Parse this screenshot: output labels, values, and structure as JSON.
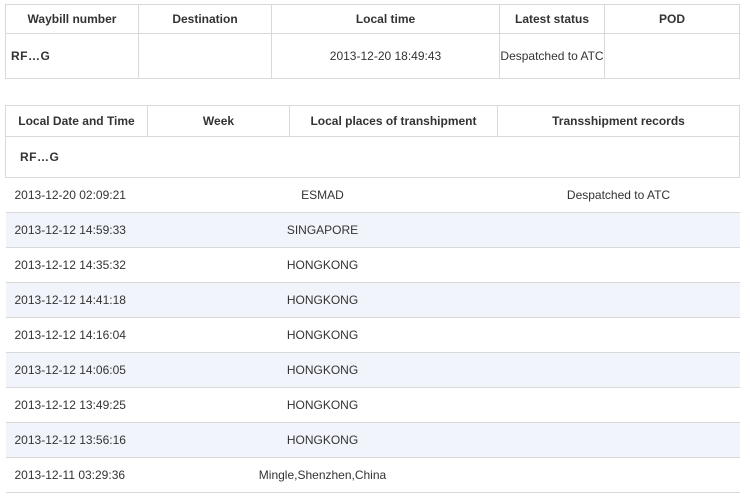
{
  "summary": {
    "headers": [
      "Waybill number",
      "Destination",
      "Local time",
      "Latest status",
      "POD"
    ],
    "waybill": "RF…G",
    "destination": "",
    "local_time": "2013-12-20 18:49:43",
    "latest_status": "Despatched to ATC",
    "pod": ""
  },
  "detail": {
    "headers": [
      "Local Date and Time",
      "Week",
      "Local places of transhipment",
      "Transshipment records"
    ],
    "waybill": "RF…G",
    "rows": [
      {
        "datetime": "2013-12-20 02:09:21",
        "place": "ESMAD",
        "record": "Despatched to ATC"
      },
      {
        "datetime": "2013-12-12 14:59:33",
        "place": "SINGAPORE",
        "record": ""
      },
      {
        "datetime": "2013-12-12 14:35:32",
        "place": "HONGKONG",
        "record": ""
      },
      {
        "datetime": "2013-12-12 14:41:18",
        "place": "HONGKONG",
        "record": ""
      },
      {
        "datetime": "2013-12-12 14:16:04",
        "place": "HONGKONG",
        "record": ""
      },
      {
        "datetime": "2013-12-12 14:06:05",
        "place": "HONGKONG",
        "record": ""
      },
      {
        "datetime": "2013-12-12 13:49:25",
        "place": "HONGKONG",
        "record": ""
      },
      {
        "datetime": "2013-12-12 13:56:16",
        "place": "HONGKONG",
        "record": ""
      },
      {
        "datetime": "2013-12-11 03:29:36",
        "place": "Mingle,Shenzhen,China",
        "record": ""
      }
    ]
  },
  "colors": {
    "row_alt": "#f1f5fb",
    "border": "#d9d9d9"
  }
}
